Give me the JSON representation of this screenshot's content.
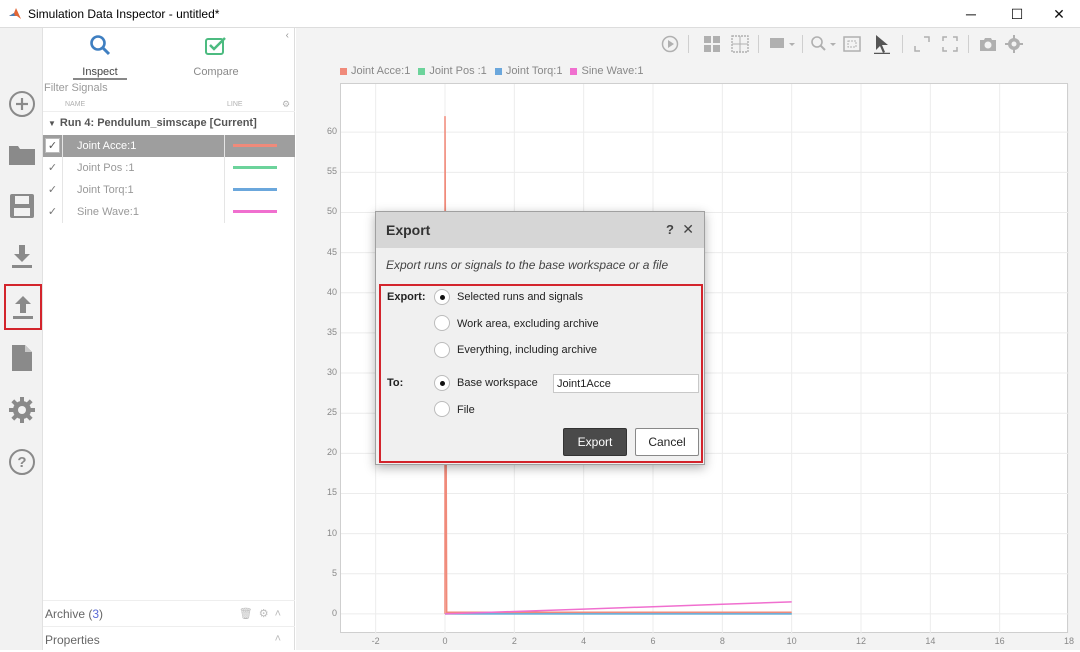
{
  "window": {
    "title": "Simulation Data Inspector - untitled*",
    "controls": {
      "minimize": "─",
      "maximize": "☐",
      "close": "✕"
    }
  },
  "rail": {
    "items": [
      {
        "name": "new-icon"
      },
      {
        "name": "open-folder-icon"
      },
      {
        "name": "save-icon"
      },
      {
        "name": "import-icon"
      },
      {
        "name": "export-icon",
        "highlighted": true
      },
      {
        "name": "report-icon"
      },
      {
        "name": "settings-icon"
      },
      {
        "name": "help-icon"
      }
    ]
  },
  "tabs": {
    "inspect": "Inspect",
    "compare": "Compare"
  },
  "signals": {
    "filter_placeholder": "Filter Signals",
    "col_name": "NAME",
    "col_line": "LINE",
    "run_label": "Run 4: Pendulum_simscape [Current]",
    "rows": [
      {
        "name": "Joint Acce:1",
        "color": "#f08a7a",
        "selected": true,
        "checked": true
      },
      {
        "name": "Joint Pos :1",
        "color": "#6cd39b",
        "selected": false,
        "checked": true
      },
      {
        "name": "Joint Torq:1",
        "color": "#6ba7dc",
        "selected": false,
        "checked": true
      },
      {
        "name": "Sine Wave:1",
        "color": "#f06fcf",
        "selected": false,
        "checked": true
      }
    ],
    "checkmark": "✓"
  },
  "footer": {
    "archive_label": "Archive (",
    "archive_count": "3",
    "archive_close": ")",
    "properties_label": "Properties"
  },
  "chart_data": {
    "type": "line",
    "xlim": [
      -3,
      18
    ],
    "ylim": [
      -2.5,
      66
    ],
    "x_ticks": [
      -2,
      0,
      2,
      4,
      6,
      8,
      10,
      12,
      14,
      16,
      18
    ],
    "y_ticks": [
      0,
      5,
      10,
      15,
      20,
      25,
      30,
      35,
      40,
      45,
      50,
      55,
      60
    ],
    "grid": true,
    "legend_position": "top-left",
    "series": [
      {
        "name": "Joint Acce:1",
        "color": "#f08a7a",
        "x": [
          0,
          0,
          0.05,
          10
        ],
        "y": [
          0,
          62,
          0.2,
          0.2
        ]
      },
      {
        "name": "Joint Pos :1",
        "color": "#6cd39b",
        "x": [
          0,
          10
        ],
        "y": [
          0,
          0
        ]
      },
      {
        "name": "Joint Torq:1",
        "color": "#6ba7dc",
        "x": [
          0,
          10
        ],
        "y": [
          0,
          0
        ]
      },
      {
        "name": "Sine Wave:1",
        "color": "#f06fcf",
        "x": [
          0,
          2,
          4,
          6,
          8,
          10
        ],
        "y": [
          0,
          0.3,
          0.6,
          0.9,
          1.2,
          1.5
        ]
      }
    ]
  },
  "dialog": {
    "title": "Export",
    "help": "?",
    "close": "✕",
    "description": "Export runs or signals to the base workspace or a file",
    "export_label": "Export:",
    "export_options": [
      {
        "label": "Selected runs and signals",
        "selected": true
      },
      {
        "label": "Work area, excluding archive",
        "selected": false
      },
      {
        "label": "Everything, including archive",
        "selected": false
      }
    ],
    "to_label": "To:",
    "to_options": [
      {
        "label": "Base workspace",
        "selected": true
      },
      {
        "label": "File",
        "selected": false
      }
    ],
    "variable_name": "Joint1Acce",
    "export_button": "Export",
    "cancel_button": "Cancel"
  }
}
